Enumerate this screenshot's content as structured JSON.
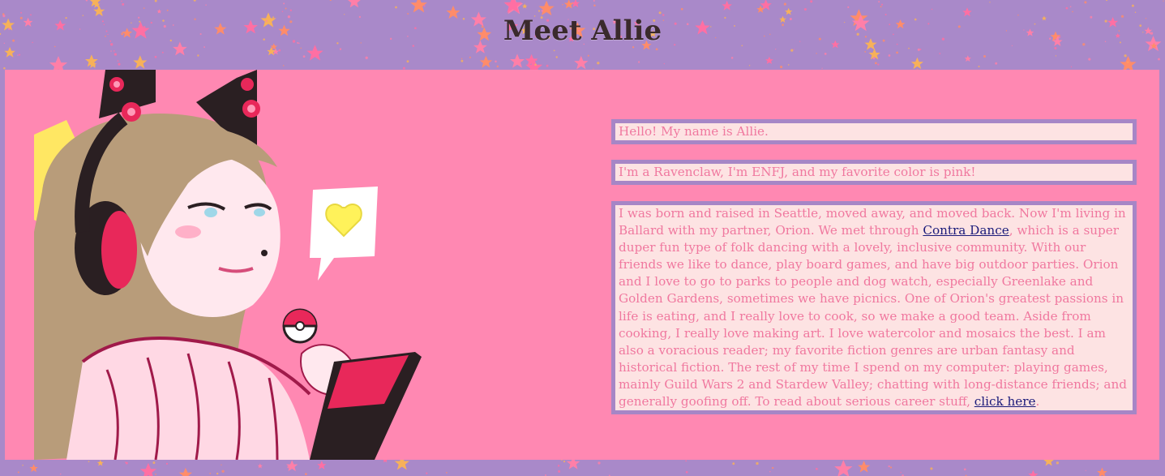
{
  "page": {
    "title": "Meet Allie",
    "background_color": "#a989c9",
    "panel_color": "#ff88b2"
  },
  "portrait": {
    "description_icon": "allie-portrait-illustration"
  },
  "intro": {
    "line1": "Hello! My name is Allie.",
    "line2": "I'm a Ravenclaw, I'm ENFJ, and my favorite color is pink!"
  },
  "bio": {
    "part1": "I was born and raised in Seattle, moved away, and moved back. Now I'm living in Ballard with my partner, Orion. We met through ",
    "link1": "Contra Dance",
    "part2": ", which is a super duper fun type of folk dancing with a lovely, inclusive community. With our friends we like to dance, play board games, and have big outdoor parties. Orion and I love to go to parks to people and dog watch, especially Greenlake and Golden Gardens, sometimes we have picnics. One of Orion's greatest passions in life is eating, and I really love to cook, so we make a good team. Aside from cooking, I really love making art. I love watercolor and mosaics the best. I am also a voracious reader; my favorite fiction genres are urban fantasy and historical fiction. The rest of my time I spend on my computer: playing games, mainly Guild Wars 2 and Stardew Valley; chatting with long-distance friends; and generally goofing off. To read about serious career stuff, ",
    "link2": "click here",
    "part3": "."
  },
  "colors": {
    "text": "#f0789f",
    "box_bg": "#fde3e3",
    "box_border": "#a686c6",
    "link": "#1a1a7a"
  }
}
